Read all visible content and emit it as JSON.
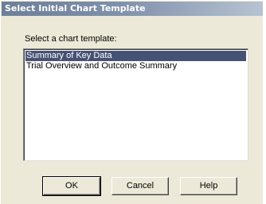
{
  "dialog": {
    "title": "Select Initial Chart Template",
    "prompt": "Select a chart template:",
    "templates": [
      {
        "label": "Summary of Key Data",
        "selected": true
      },
      {
        "label": "Trial Overview and Outcome Summary",
        "selected": false
      }
    ],
    "buttons": {
      "ok": "OK",
      "cancel": "Cancel",
      "help": "Help"
    }
  },
  "colors": {
    "titlebar_start": "#6d7f99",
    "titlebar_end": "#b7c3d2",
    "selection": "#465274",
    "dialog_face": "#ece9d8"
  }
}
